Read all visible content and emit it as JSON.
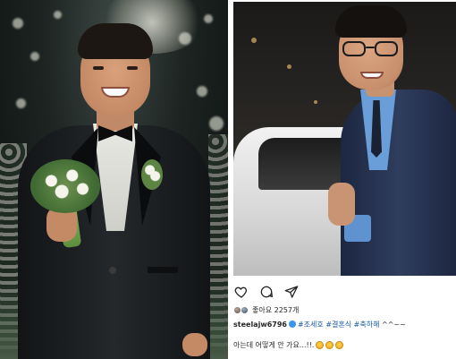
{
  "post": {
    "likes_label": "좋아요 2257개",
    "caption": {
      "username": "steelajw6796",
      "hashtags": [
        "#조세호",
        "#결혼식",
        "#축하해"
      ],
      "tail": "^^~~"
    },
    "comment": {
      "text": "아는데 어떻게 안 가요...!!.",
      "emoji_count": 3
    },
    "icons": [
      "heart-icon",
      "comment-icon",
      "share-icon"
    ]
  },
  "colors": {
    "hashtag": "#1a5aa8",
    "verified": "#3897f0",
    "text": "#262626"
  }
}
